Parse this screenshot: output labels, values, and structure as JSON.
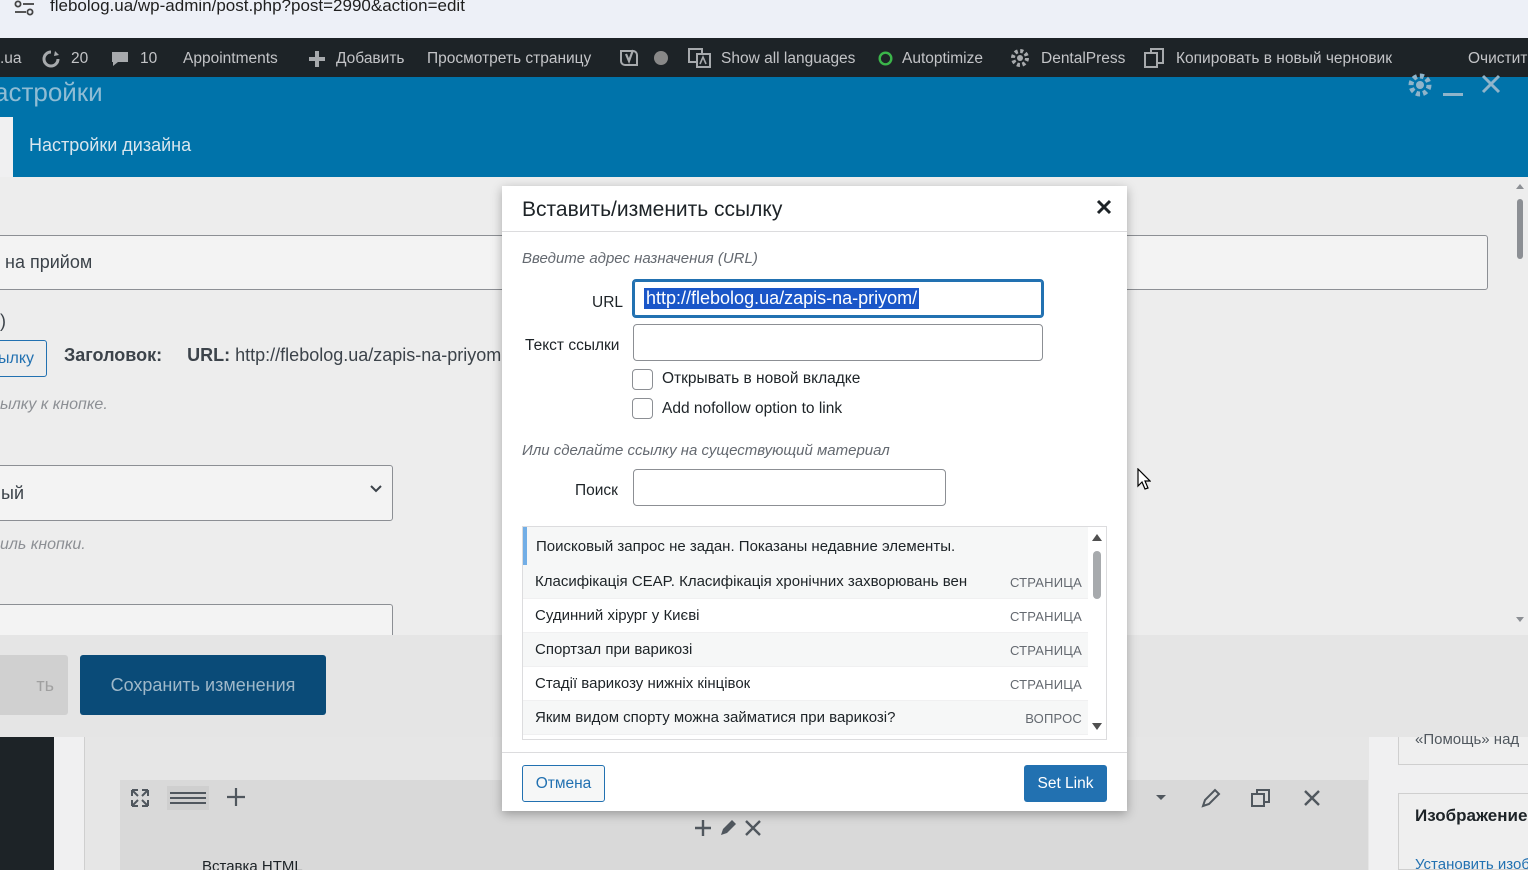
{
  "browser": {
    "url": "flebolog.ua/wp-admin/post.php?post=2990&action=edit"
  },
  "adminbar": {
    "site": ".ua",
    "updates_count": "20",
    "comments_count": "10",
    "appointments": "Appointments",
    "add_new": "Добавить",
    "view_page": "Просмотреть страницу",
    "show_languages": "Show all languages",
    "autoptimize": "Autoptimize",
    "dentalpress": "DentalPress",
    "copy_draft": "Копировать в новый черновик",
    "clear": "Очистит"
  },
  "settings_modal": {
    "title": "астройки",
    "tab_design": "Настройки дизайна",
    "field_value": "на прийом",
    "paren": ")",
    "link_button": "ылку",
    "title_label": "Заголовок:",
    "url_label": "URL:",
    "url_value": "http://flebolog.ua/zapis-na-priyom",
    "hint_link": "ылку к кнопке.",
    "select_value": "ый",
    "hint_style": "иль кнопки.",
    "prev_button": "ть",
    "save_button": "Сохранить изменения"
  },
  "editor": {
    "html_block": "Вставка HTML",
    "sidebar_help": "«Помощь» над",
    "sidebar_image_title": "Изображение",
    "sidebar_image_link": "Установить изоб"
  },
  "link_dialog": {
    "title": "Вставить/изменить ссылку",
    "url_hint": "Введите адрес назначения (URL)",
    "url_label": "URL",
    "url_value": "http://flebolog.ua/zapis-na-priyom/",
    "text_label": "Текст ссылки",
    "text_value": "",
    "new_tab_label": "Открывать в новой вкладке",
    "nofollow_label": "Add nofollow option to link",
    "existing_hint": "Или сделайте ссылку на существующий материал",
    "search_label": "Поиск",
    "search_value": "",
    "notice": "Поисковый запрос не задан. Показаны недавние элементы.",
    "results": [
      {
        "title": "Класифікація CEAP. Класифікація хронічних захворювань вен",
        "kind": "Страница"
      },
      {
        "title": "Судинний хірург у Києві",
        "kind": "Страница"
      },
      {
        "title": "Спортзал при варикозі",
        "kind": "Страница"
      },
      {
        "title": "Стадії варикозу нижніх кінцівок",
        "kind": "Страница"
      },
      {
        "title": "Яким видом спорту можна займатися при варикозі?",
        "kind": "Вопрос"
      }
    ],
    "cancel_label": "Отмена",
    "submit_label": "Set Link"
  },
  "colors": {
    "wp_blue": "#2271b1",
    "adminbar_bg": "#1d2327",
    "modal_header": "#0073aa"
  }
}
